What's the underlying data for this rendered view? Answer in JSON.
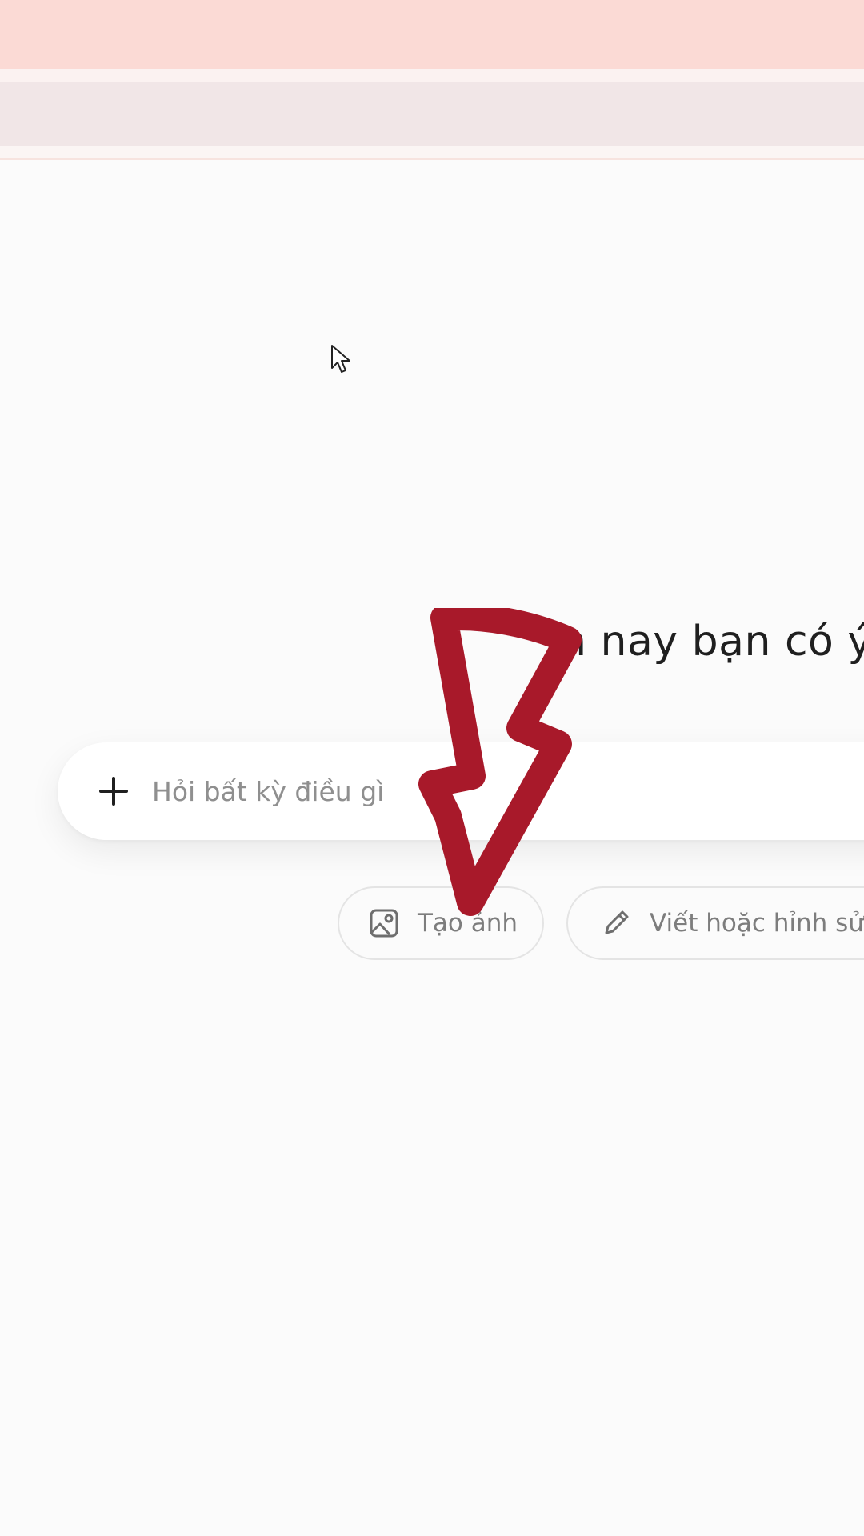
{
  "greeting": {
    "text": "n nay bạn có ý"
  },
  "composer": {
    "placeholder": "Hỏi bất kỳ điều gì",
    "add_icon": "plus-icon"
  },
  "suggestions": [
    {
      "label": "Tạo ảnh",
      "icon": "image-icon"
    },
    {
      "label": "Viết hoặc hỉnh sửa",
      "icon": "pencil-icon"
    }
  ],
  "annotation": {
    "type": "arrow",
    "color": "#a8192a"
  },
  "colors": {
    "top_bar": "#fbdad5",
    "tab_strip": "#f1e6e7",
    "background": "#fbfbfb",
    "arrow": "#a8192a"
  }
}
